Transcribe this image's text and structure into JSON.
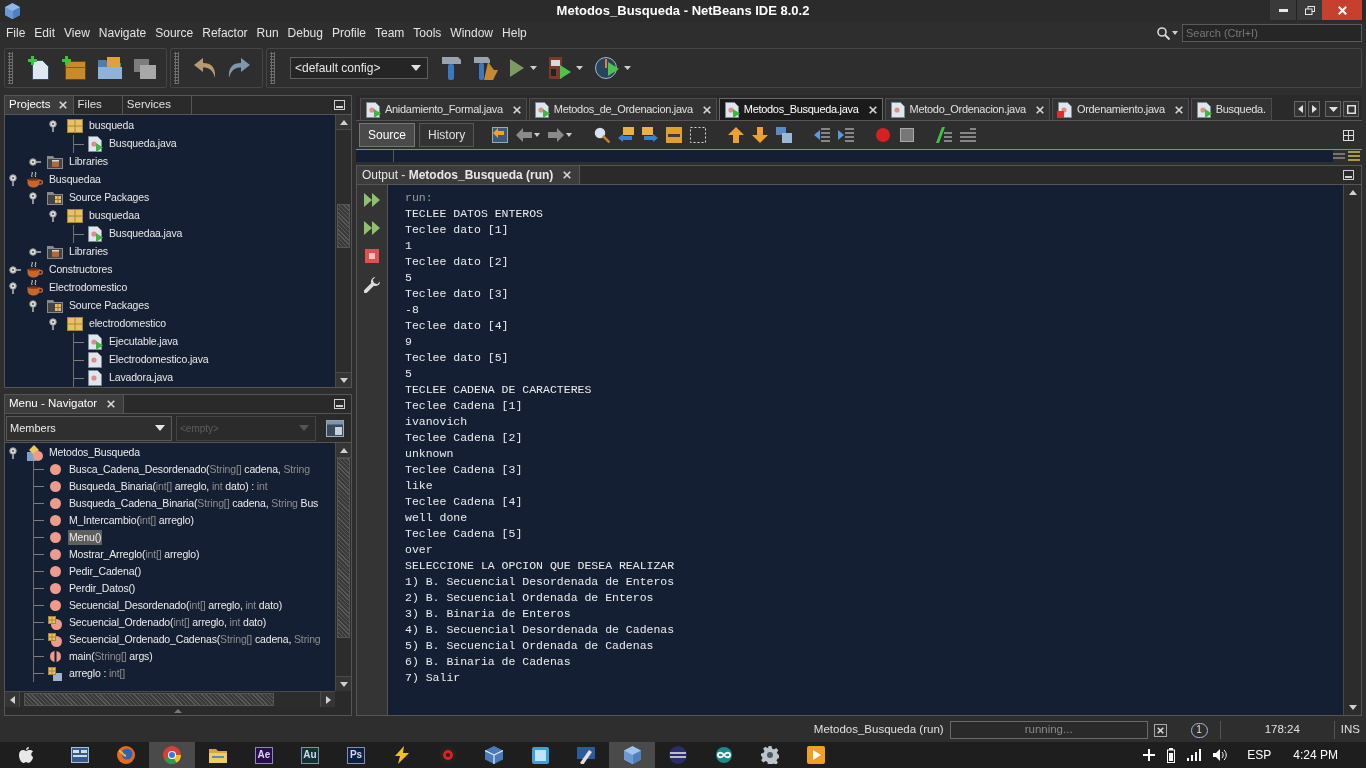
{
  "window": {
    "title": "Metodos_Busqueda - NetBeans IDE 8.0.2"
  },
  "menu": [
    "File",
    "Edit",
    "View",
    "Navigate",
    "Source",
    "Refactor",
    "Run",
    "Debug",
    "Profile",
    "Team",
    "Tools",
    "Window",
    "Help"
  ],
  "search": {
    "placeholder": "Search (Ctrl+I)"
  },
  "toolbar": {
    "config": "<default config>"
  },
  "projects": {
    "tabs": [
      {
        "label": "Projects",
        "selected": true
      },
      {
        "label": "Files",
        "selected": false
      },
      {
        "label": "Services",
        "selected": false
      }
    ],
    "tree": [
      {
        "children": [
          {
            "children": [
              {
                "label": "busqueda",
                "kind": "package",
                "expanded": true,
                "children": [
                  {
                    "label": "Busqueda.java",
                    "kind": "main-class"
                  }
                ]
              }
            ]
          },
          {
            "label": "Libraries",
            "kind": "libraries",
            "expanded": false
          }
        ]
      },
      {
        "label": "Busquedaa",
        "kind": "project",
        "expanded": true,
        "children": [
          {
            "label": "Source Packages",
            "kind": "source-packages",
            "expanded": true,
            "children": [
              {
                "label": "busquedaa",
                "kind": "package",
                "expanded": true,
                "children": [
                  {
                    "label": "Busquedaa.java",
                    "kind": "main-class"
                  }
                ]
              }
            ]
          },
          {
            "label": "Libraries",
            "kind": "libraries",
            "expanded": false
          }
        ]
      },
      {
        "label": "Constructores",
        "kind": "project",
        "expanded": false
      },
      {
        "label": "Electrodomestico",
        "kind": "project",
        "expanded": true,
        "children": [
          {
            "label": "Source Packages",
            "kind": "source-packages",
            "expanded": true,
            "children": [
              {
                "label": "electrodomestico",
                "kind": "package",
                "expanded": true,
                "children": [
                  {
                    "label": "Ejecutable.java",
                    "kind": "main-class"
                  },
                  {
                    "label": "Electrodomestico.java",
                    "kind": "class"
                  },
                  {
                    "label": "Lavadora.java",
                    "kind": "class"
                  }
                ]
              }
            ]
          }
        ]
      }
    ]
  },
  "navigator": {
    "title": "Menu - Navigator",
    "filter": "Members",
    "scope": {
      "value": "<empty>",
      "disabled": true
    },
    "tree": [
      {
        "label": "Metodos_Busqueda",
        "kind": "class",
        "expanded": true,
        "children": [
          {
            "kind": "method",
            "selected": false,
            "segments": [
              {
                "kind": "plain",
                "text": "Busca_Cadena_Desordenado("
              },
              {
                "kind": "type",
                "text": "String[]"
              },
              {
                "kind": "plain",
                "text": " cadena, "
              },
              {
                "kind": "type",
                "text": "String"
              }
            ]
          },
          {
            "kind": "method",
            "selected": false,
            "segments": [
              {
                "kind": "plain",
                "text": "Busqueda_Binaria("
              },
              {
                "kind": "type",
                "text": "int[]"
              },
              {
                "kind": "plain",
                "text": " arreglo, "
              },
              {
                "kind": "type",
                "text": "int"
              },
              {
                "kind": "plain",
                "text": " dato) : "
              },
              {
                "kind": "type",
                "text": "int"
              }
            ]
          },
          {
            "kind": "method",
            "selected": false,
            "segments": [
              {
                "kind": "plain",
                "text": "Busqueda_Cadena_Binaria("
              },
              {
                "kind": "type",
                "text": "String[]"
              },
              {
                "kind": "plain",
                "text": " cadena, "
              },
              {
                "kind": "type",
                "text": "String"
              },
              {
                "kind": "plain",
                "text": " Bus"
              }
            ]
          },
          {
            "kind": "method",
            "selected": false,
            "segments": [
              {
                "kind": "plain",
                "text": "M_Intercambio("
              },
              {
                "kind": "type",
                "text": "int[]"
              },
              {
                "kind": "plain",
                "text": " arreglo)"
              }
            ]
          },
          {
            "kind": "method",
            "selected": true,
            "segments": [
              {
                "kind": "plain",
                "text": "Menu()"
              }
            ]
          },
          {
            "kind": "method",
            "selected": false,
            "segments": [
              {
                "kind": "plain",
                "text": "Mostrar_Arreglo("
              },
              {
                "kind": "type",
                "text": "int[]"
              },
              {
                "kind": "plain",
                "text": " arreglo)"
              }
            ]
          },
          {
            "kind": "method",
            "selected": false,
            "segments": [
              {
                "kind": "plain",
                "text": "Pedir_Cadena()"
              }
            ]
          },
          {
            "kind": "method",
            "selected": false,
            "segments": [
              {
                "kind": "plain",
                "text": "Perdir_Datos()"
              }
            ]
          },
          {
            "kind": "method",
            "selected": false,
            "segments": [
              {
                "kind": "plain",
                "text": "Secuencial_Desordenado("
              },
              {
                "kind": "type",
                "text": "int[]"
              },
              {
                "kind": "plain",
                "text": " arreglo, "
              },
              {
                "kind": "type",
                "text": "int"
              },
              {
                "kind": "plain",
                "text": " dato)"
              }
            ]
          },
          {
            "kind": "badged",
            "selected": false,
            "segments": [
              {
                "kind": "plain",
                "text": "Secuencial_Ordenado("
              },
              {
                "kind": "type",
                "text": "int[]"
              },
              {
                "kind": "plain",
                "text": " arreglo, "
              },
              {
                "kind": "type",
                "text": "int"
              },
              {
                "kind": "plain",
                "text": " dato)"
              }
            ]
          },
          {
            "kind": "badged",
            "selected": false,
            "segments": [
              {
                "kind": "plain",
                "text": "Secuencial_Ordenado_Cadenas("
              },
              {
                "kind": "type",
                "text": "String[]"
              },
              {
                "kind": "plain",
                "text": " cadena, "
              },
              {
                "kind": "type",
                "text": "String"
              }
            ]
          },
          {
            "kind": "split",
            "selected": false,
            "segments": [
              {
                "kind": "plain",
                "text": "main("
              },
              {
                "kind": "type",
                "text": "String[]"
              },
              {
                "kind": "plain",
                "text": " args)"
              }
            ]
          },
          {
            "kind": "field",
            "selected": false,
            "segments": [
              {
                "kind": "plain",
                "text": "arreglo : "
              },
              {
                "kind": "type",
                "text": "int[]"
              }
            ]
          }
        ]
      }
    ]
  },
  "editor": {
    "tabs": [
      {
        "label": "Anidamiento_Formal.java",
        "kind": "main-class",
        "selected": false,
        "closable": true
      },
      {
        "label": "Metodos_de_Ordenacion.java",
        "kind": "main-class",
        "selected": false,
        "closable": true
      },
      {
        "label": "Metodos_Busqueda.java",
        "kind": "main-class",
        "selected": true,
        "closable": true
      },
      {
        "label": "Metodo_Ordenacion.java",
        "kind": "class",
        "selected": false,
        "closable": true
      },
      {
        "label": "Ordenamiento.java",
        "kind": "error",
        "selected": false,
        "closable": true
      },
      {
        "label": "Busqueda.",
        "kind": "main-class",
        "selected": false,
        "closable": false
      }
    ],
    "views": [
      {
        "label": "Source",
        "selected": true
      },
      {
        "label": "History",
        "selected": false
      }
    ]
  },
  "output": {
    "title": "Output - **Metodos_Busqueda (run)**",
    "lines": [
      {
        "kind": "status",
        "text": "run:"
      },
      {
        "kind": "plain",
        "text": "TECLEE DATOS ENTEROS"
      },
      {
        "kind": "plain",
        "text": "Teclee dato [1]"
      },
      {
        "kind": "plain",
        "text": "1"
      },
      {
        "kind": "plain",
        "text": "Teclee dato [2]"
      },
      {
        "kind": "plain",
        "text": "5"
      },
      {
        "kind": "plain",
        "text": "Teclee dato [3]"
      },
      {
        "kind": "plain",
        "text": "-8"
      },
      {
        "kind": "plain",
        "text": "Teclee dato [4]"
      },
      {
        "kind": "plain",
        "text": "9"
      },
      {
        "kind": "plain",
        "text": "Teclee dato [5]"
      },
      {
        "kind": "plain",
        "text": "5"
      },
      {
        "kind": "plain",
        "text": "TECLEE CADENA DE CARACTERES"
      },
      {
        "kind": "plain",
        "text": "Teclee Cadena [1]"
      },
      {
        "kind": "plain",
        "text": "ivanovich"
      },
      {
        "kind": "plain",
        "text": "Teclee Cadena [2]"
      },
      {
        "kind": "plain",
        "text": "unknown"
      },
      {
        "kind": "plain",
        "text": "Teclee Cadena [3]"
      },
      {
        "kind": "plain",
        "text": "like"
      },
      {
        "kind": "plain",
        "text": "Teclee Cadena [4]"
      },
      {
        "kind": "plain",
        "text": "well done"
      },
      {
        "kind": "plain",
        "text": "Teclee Cadena [5]"
      },
      {
        "kind": "plain",
        "text": "over"
      },
      {
        "kind": "plain",
        "text": "SELECCIONE LA OPCION QUE DESEA REALIZAR"
      },
      {
        "kind": "plain",
        "text": "1) B. Secuencial Desordenada de Enteros"
      },
      {
        "kind": "plain",
        "text": "2) B. Secuencial Ordenada de Enteros"
      },
      {
        "kind": "plain",
        "text": "3) B. Binaria de Enteros"
      },
      {
        "kind": "plain",
        "text": "4) B. Secuencial Desordenada de Cadenas"
      },
      {
        "kind": "plain",
        "text": "5) B. Secuencial Ordenada de Cadenas"
      },
      {
        "kind": "plain",
        "text": "6) B. Binaria de Cadenas"
      },
      {
        "kind": "plain",
        "text": "7) Salir"
      }
    ]
  },
  "status_bar": {
    "task": "Metodos_Busqueda (run)",
    "progress": "running...",
    "notifications": "1",
    "position": "178:24",
    "mode": "INS"
  },
  "taskbar": {
    "items": [
      {
        "kind": "apple",
        "selected": false
      },
      {
        "kind": "window",
        "selected": false
      },
      {
        "kind": "fox",
        "selected": false
      },
      {
        "kind": "ring",
        "selected": true
      },
      {
        "kind": "folder",
        "selected": false
      },
      {
        "kind": "letters",
        "label": "Ae",
        "color": "#2a0b4e",
        "selected": false
      },
      {
        "kind": "letters",
        "label": "Au",
        "color": "#0f3434",
        "selected": false
      },
      {
        "kind": "letters",
        "label": "Ps",
        "color": "#0a2140",
        "selected": false
      },
      {
        "kind": "bolt",
        "selected": false
      },
      {
        "kind": "record",
        "selected": false
      },
      {
        "kind": "box",
        "selected": false
      },
      {
        "kind": "square",
        "selected": false
      },
      {
        "kind": "pencil",
        "selected": false
      },
      {
        "kind": "cube",
        "selected": true
      },
      {
        "kind": "orb",
        "selected": false
      },
      {
        "kind": "infinity",
        "selected": false
      },
      {
        "kind": "gear",
        "selected": false
      },
      {
        "kind": "play",
        "selected": false
      }
    ],
    "tray": {
      "language": "ESP",
      "time": "4:24 PM"
    }
  }
}
